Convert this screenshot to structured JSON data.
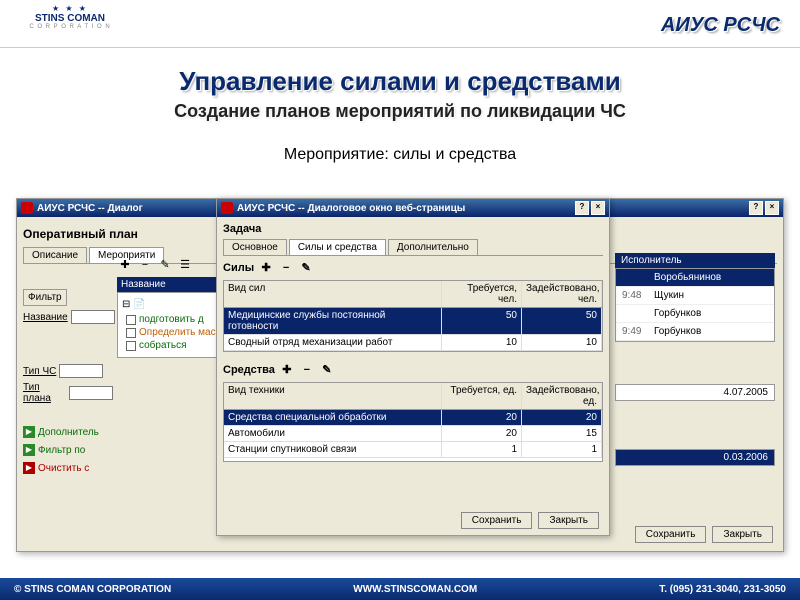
{
  "logo": {
    "line1": "STINS COMAN",
    "corp": "C O R P O R A T I O N"
  },
  "system_title": "АИУС РСЧС",
  "page_title": "Управление силами и средствами",
  "page_subtitle": "Создание планов мероприятий по ликвидации ЧС",
  "section_title": "Мероприятие: силы и средства",
  "win1": {
    "title": "АИУС РСЧС -- Диалог",
    "plan_title": "Оперативный план",
    "tabs": [
      "Описание",
      "Мероприяти"
    ],
    "tree_header": "Название",
    "tree_items": [
      {
        "label": "подготовить д",
        "cls": "green"
      },
      {
        "label": "Определить масс",
        "cls": "orange"
      },
      {
        "label": "собраться",
        "cls": "green"
      }
    ],
    "filter_label": "Фильтр",
    "fields": {
      "name": "Название",
      "type": "Тип ЧС",
      "plan": "Тип плана"
    },
    "links": [
      {
        "label": "Дополнитель",
        "cls": "link"
      },
      {
        "label": "Фильтр по",
        "cls": "link"
      },
      {
        "label": "Очистить с",
        "cls": "red"
      }
    ],
    "right_header": "Исполнитель",
    "right_rows": [
      {
        "time": "",
        "name": "Воробьянинов",
        "sel": true
      },
      {
        "time": "9:48",
        "name": "Щукин"
      },
      {
        "time": "",
        "name": "Горбунков"
      },
      {
        "time": "9:49",
        "name": "Горбунков"
      }
    ],
    "date1": "4.07.2005",
    "date2": "0.03.2006"
  },
  "win2": {
    "title": "АИУС РСЧС -- Диалоговое окно веб-страницы",
    "task_label": "Задача",
    "tabs": [
      "Основное",
      "Силы и средства",
      "Дополнительно"
    ],
    "forces": {
      "label": "Силы",
      "cols": [
        "Вид сил",
        "Требуется, чел.",
        "Задействовано, чел."
      ],
      "rows": [
        {
          "name": "Медицинские службы постоянной готовности",
          "req": 50,
          "used": 50,
          "sel": true
        },
        {
          "name": "Сводный отряд механизации работ",
          "req": 10,
          "used": 10
        }
      ]
    },
    "means": {
      "label": "Средства",
      "cols": [
        "Вид техники",
        "Требуется, ед.",
        "Задействовано, ед."
      ],
      "rows": [
        {
          "name": "Средства специальной обработки",
          "req": 20,
          "used": 20,
          "sel": true
        },
        {
          "name": "Автомобили",
          "req": 20,
          "used": 15
        },
        {
          "name": "Станции спутниковой связи",
          "req": 1,
          "used": 1
        }
      ]
    }
  },
  "buttons": {
    "save": "Сохранить",
    "close": "Закрыть"
  },
  "footer": {
    "left": "© STINS COMAN CORPORATION",
    "center": "WWW.STINSCOMAN.COM",
    "right": "Т. (095) 231-3040, 231-3050"
  }
}
